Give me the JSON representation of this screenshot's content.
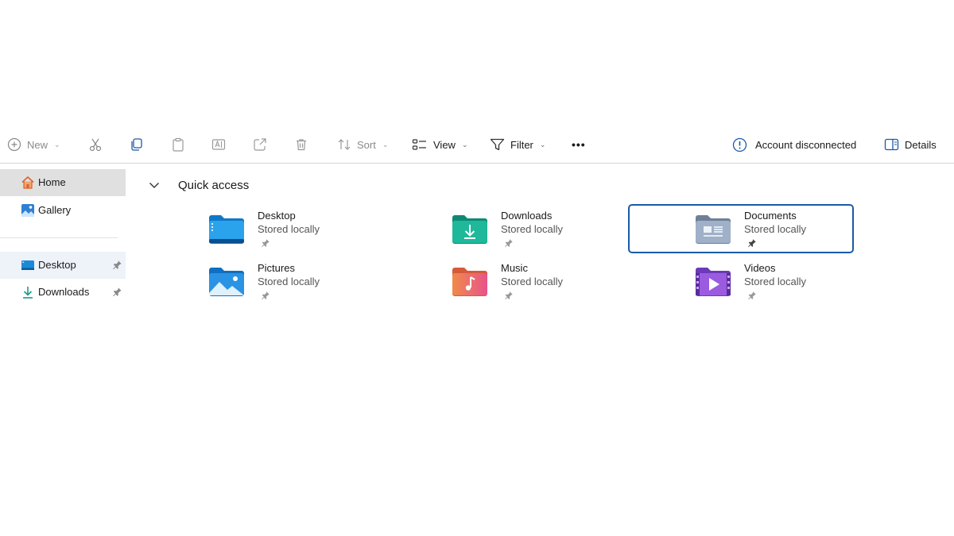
{
  "toolbar": {
    "new_label": "New",
    "sort_label": "Sort",
    "view_label": "View",
    "filter_label": "Filter",
    "more_label": "•••",
    "account_label": "Account disconnected",
    "details_label": "Details"
  },
  "sidebar": {
    "items": [
      {
        "label": "Home",
        "icon": "home-icon",
        "pinned": false
      },
      {
        "label": "Gallery",
        "icon": "gallery-icon",
        "pinned": false
      },
      {
        "label": "Desktop",
        "icon": "desktop-folder-icon",
        "pinned": true
      },
      {
        "label": "Downloads",
        "icon": "download-icon",
        "pinned": true
      }
    ]
  },
  "main": {
    "section_title": "Quick access",
    "tiles": [
      {
        "name": "Desktop",
        "status": "Stored locally",
        "icon": "desktop-folder-icon"
      },
      {
        "name": "Downloads",
        "status": "Stored locally",
        "icon": "downloads-folder-icon"
      },
      {
        "name": "Documents",
        "status": "Stored locally",
        "icon": "documents-folder-icon"
      },
      {
        "name": "Pictures",
        "status": "Stored locally",
        "icon": "pictures-folder-icon"
      },
      {
        "name": "Music",
        "status": "Stored locally",
        "icon": "music-folder-icon"
      },
      {
        "name": "Videos",
        "status": "Stored locally",
        "icon": "videos-folder-icon"
      }
    ]
  },
  "colors": {
    "accent": "#1a5aa8",
    "sidebar_active": "#e0e0e0",
    "sidebar_selected": "#eef2f9"
  }
}
